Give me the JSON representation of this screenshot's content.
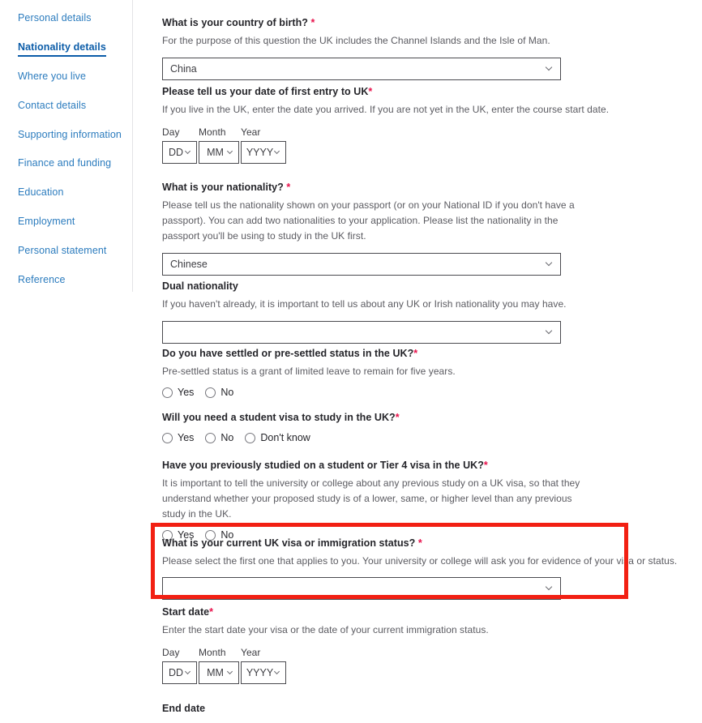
{
  "sidebar": {
    "items": [
      {
        "label": "Personal details",
        "active": false
      },
      {
        "label": "Nationality details",
        "active": true
      },
      {
        "label": "Where you live",
        "active": false
      },
      {
        "label": "Contact details",
        "active": false
      },
      {
        "label": "Supporting information",
        "active": false
      },
      {
        "label": "Finance and funding",
        "active": false
      },
      {
        "label": "Education",
        "active": false
      },
      {
        "label": "Employment",
        "active": false
      },
      {
        "label": "Personal statement",
        "active": false
      },
      {
        "label": "Reference",
        "active": false
      }
    ]
  },
  "form": {
    "required_marker": "*",
    "country_of_birth": {
      "label": "What is your country of birth?",
      "hint": "For the purpose of this question the UK includes the Channel Islands and the Isle of Man.",
      "value": "China"
    },
    "first_entry": {
      "label": "Please tell us your date of first entry to UK",
      "hint": "If you live in the UK, enter the date you arrived. If you are not yet in the UK, enter the course start date.",
      "day_header": "Day",
      "month_header": "Month",
      "year_header": "Year",
      "day_value": "DD",
      "month_value": "MM",
      "year_value": "YYYY"
    },
    "nationality": {
      "label": "What is your nationality?",
      "hint": "Please tell us the nationality shown on your passport (or on your National ID if you don't have a passport). You can add two nationalities to your application. Please list the nationality in the passport you'll be using to study in the UK first.",
      "value": "Chinese"
    },
    "dual_nationality": {
      "label": "Dual nationality",
      "hint": "If you haven't already, it is important to tell us about any UK or Irish nationality you may have.",
      "value": ""
    },
    "settled_status": {
      "label": "Do you have settled or pre-settled status in the UK?",
      "hint": "Pre-settled status is a grant of limited leave to remain for five years.",
      "options": [
        "Yes",
        "No"
      ]
    },
    "student_visa": {
      "label": "Will you need a student visa to study in the UK?",
      "options": [
        "Yes",
        "No",
        "Don't know"
      ]
    },
    "previous_study": {
      "label": "Have you previously studied on a student or Tier 4 visa in the UK?",
      "hint": "It is important to tell the university or college about any previous study on a UK visa, so that they understand whether your proposed study is of a lower, same, or higher level than any previous study in the UK.",
      "options": [
        "Yes",
        "No"
      ]
    },
    "visa_status": {
      "label": "What is your current UK visa or immigration status?",
      "hint": "Please select the first one that applies to you. Your university or college will ask you for evidence of your visa or status.",
      "value": ""
    },
    "start_date": {
      "label": "Start date",
      "hint": "Enter the start date your visa or the date of your current immigration status.",
      "day_header": "Day",
      "month_header": "Month",
      "year_header": "Year",
      "day_value": "DD",
      "month_value": "MM",
      "year_value": "YYYY"
    },
    "end_date": {
      "label": "End date"
    }
  },
  "annotation": {
    "highlight_color": "#f22013"
  },
  "colors": {
    "link": "#2c7cbe",
    "link_active": "#0b5ca8",
    "required": "#e8114b",
    "text": "#25252a",
    "hint": "#5b5b61",
    "border": "#4a4a4f"
  }
}
